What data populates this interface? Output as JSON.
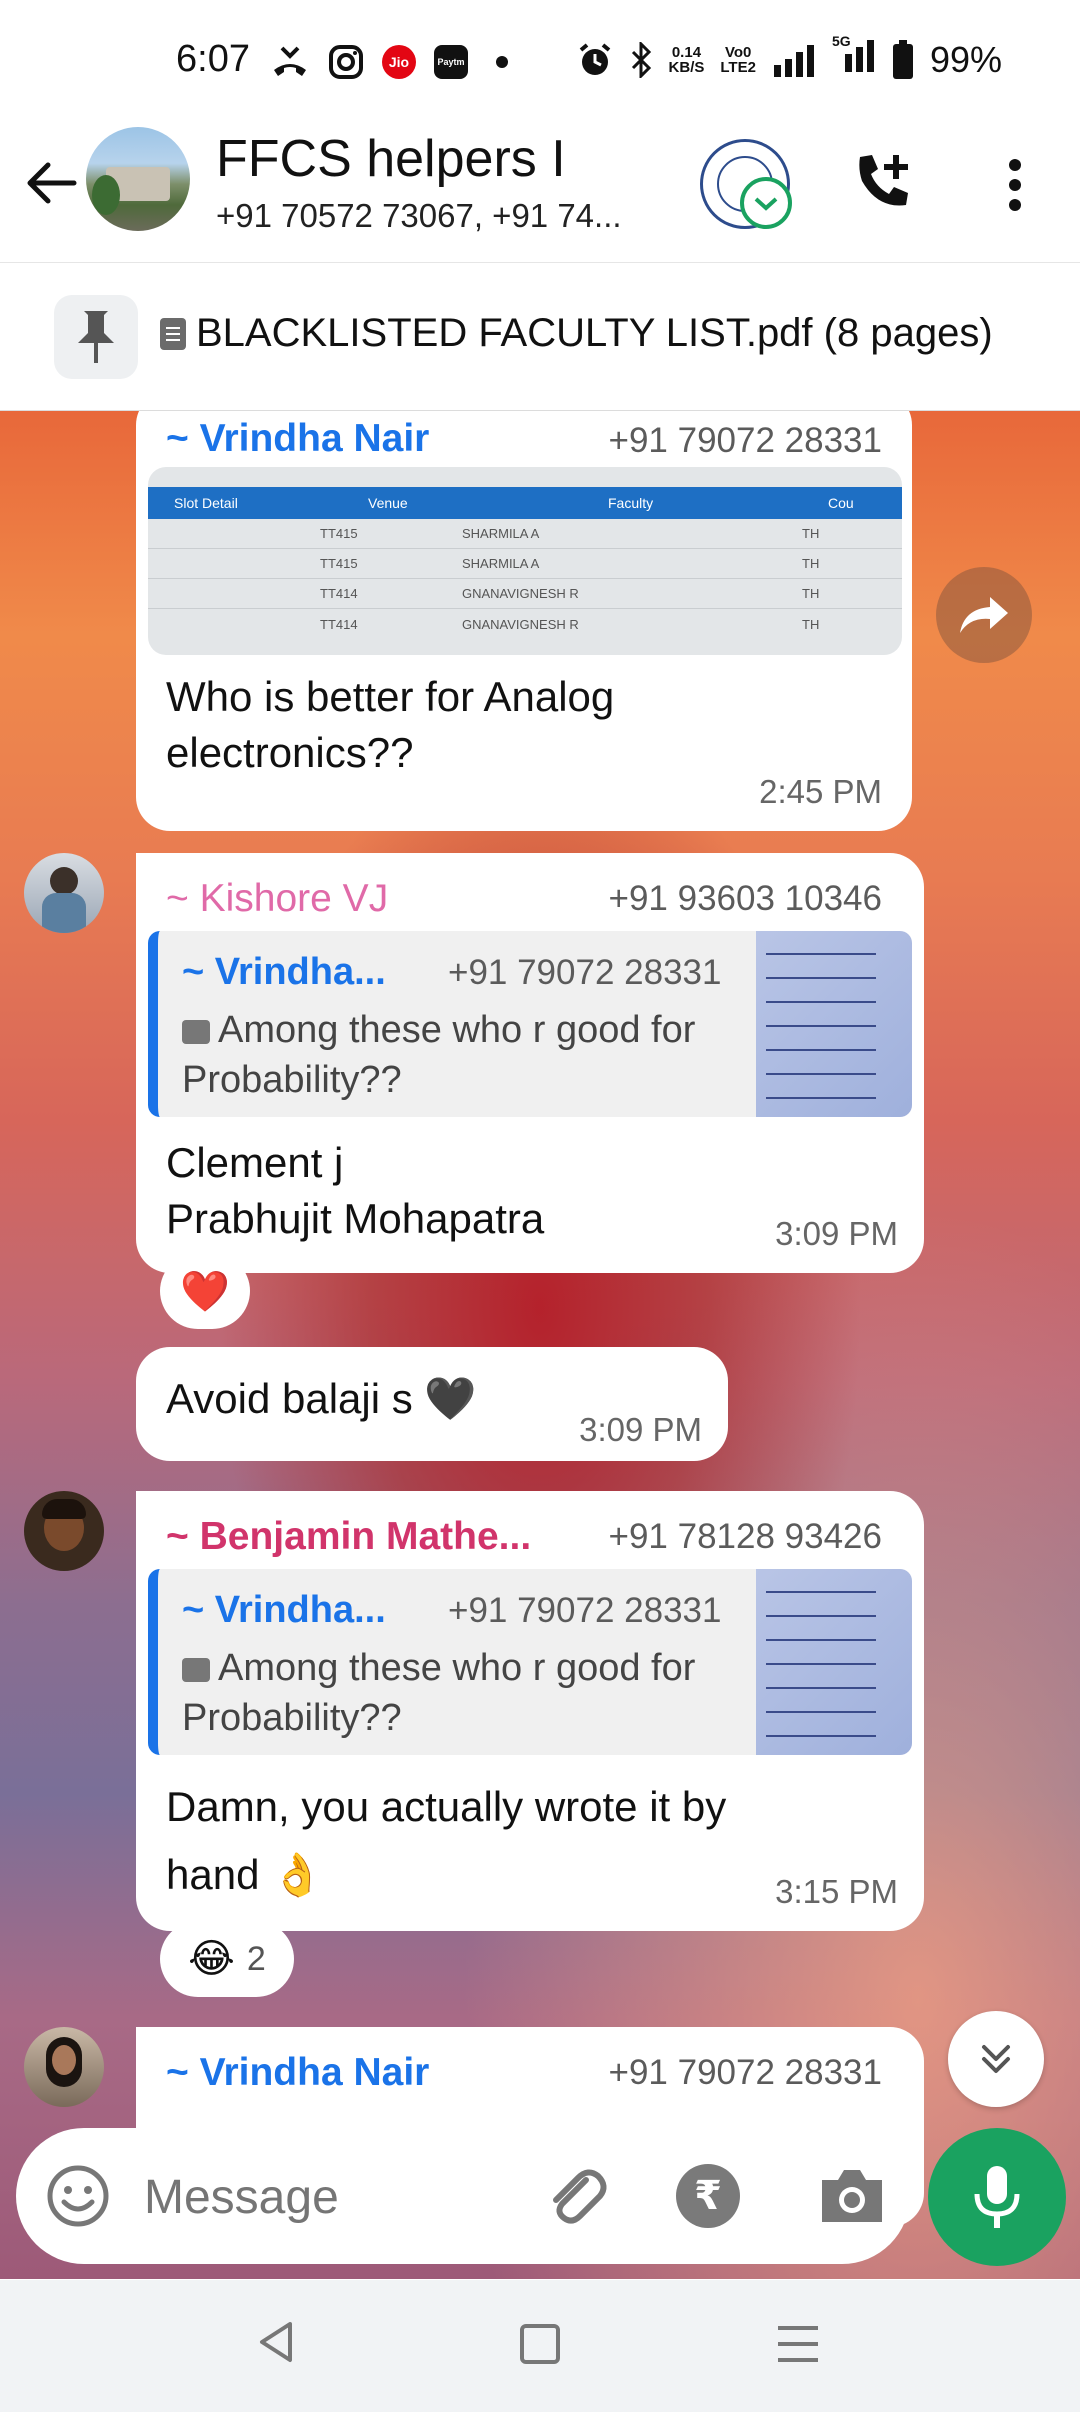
{
  "status_bar": {
    "time": "6:07",
    "data_rate_value": "0.14",
    "data_rate_unit": "KB/S",
    "volte_top": "Vo0",
    "volte_bottom": "LTE2",
    "network_type": "5G",
    "battery": "99%",
    "jio_label": "Jio",
    "paytm_label": "Paytm"
  },
  "header": {
    "group_name": "FFCS helpers I",
    "participants": "+91 70572 73067, +91 74..."
  },
  "pinned": {
    "text": "BLACKLISTED FACULTY LIST.pdf (8 pages)"
  },
  "messages": {
    "m1": {
      "sender": "~ Vrindha Nair",
      "phone": "+91 79072 28331",
      "text_line1": "Who is better for Analog",
      "text_line2": "electronics??",
      "time": "2:45 PM",
      "table": {
        "headers": [
          "Slot Detail",
          "Venue",
          "Faculty",
          "Cou"
        ],
        "rows": [
          [
            "TT415",
            "SHARMILA A",
            "TH"
          ],
          [
            "TT415",
            "SHARMILA A",
            "TH"
          ],
          [
            "TT414",
            "GNANAVIGNESH R",
            "TH"
          ],
          [
            "TT414",
            "GNANAVIGNESH R",
            "TH"
          ]
        ]
      }
    },
    "m2": {
      "sender": "~ Kishore VJ",
      "phone": "+91 93603 10346",
      "quote_name": "~ Vrindha...",
      "quote_phone": "+91 79072 28331",
      "quote_text": "Among these who r good for Probability??",
      "text_line1": "Clement j",
      "text_line2": "Prabhujit Mohapatra",
      "time": "3:09 PM",
      "reaction": "❤️"
    },
    "m3": {
      "text": "Avoid balaji s 🖤",
      "time": "3:09 PM"
    },
    "m4": {
      "sender": "~ Benjamin Mathe...",
      "phone": "+91 78128 93426",
      "quote_name": "~ Vrindha...",
      "quote_phone": "+91 79072 28331",
      "quote_text": "Among these who r good for Probability??",
      "text_line1": "Damn, you actually wrote it by",
      "text_line2": "hand 👌",
      "time": "3:15 PM",
      "reaction_emoji": "😂",
      "reaction_count": "2"
    },
    "m5": {
      "sender": "~ Vrindha Nair",
      "phone": "+91 79072 28331"
    }
  },
  "input": {
    "placeholder": "Message",
    "rupee": "₹"
  },
  "colors": {
    "vrindha": "#1a73e8",
    "kishore": "#e06aa8",
    "benjamin": "#d1346b",
    "accent_green": "#1aa260"
  },
  "icons": [
    "back-arrow-icon",
    "add-call-icon",
    "more-vert-icon",
    "pin-icon",
    "document-icon",
    "forward-icon",
    "scroll-down-icon",
    "emoji-icon",
    "attach-icon",
    "rupee-icon",
    "camera-icon",
    "mic-icon"
  ]
}
